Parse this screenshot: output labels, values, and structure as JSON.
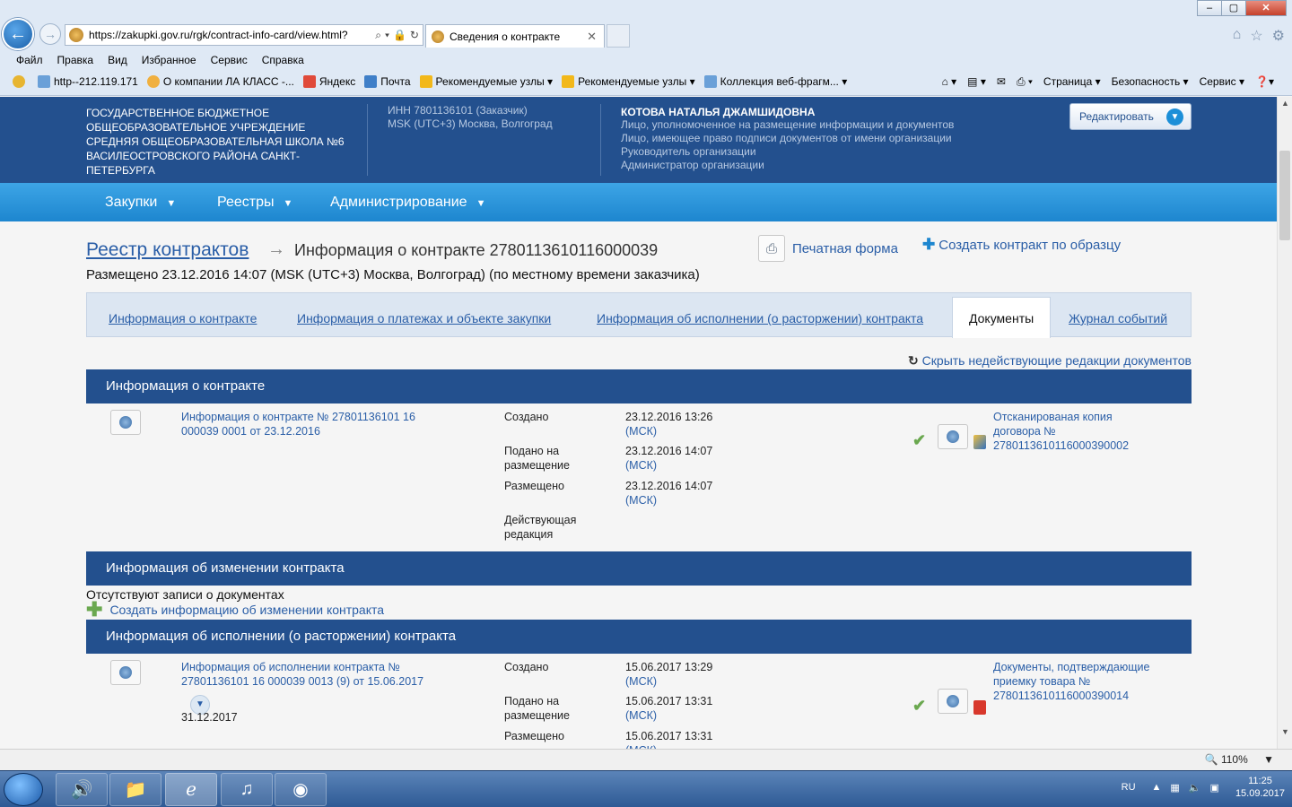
{
  "browser": {
    "address_url": "https://zakupki.gov.ru/rgk/contract-info-card/view.html?",
    "tab_title": "Сведения о контракте",
    "menu": [
      "Файл",
      "Правка",
      "Вид",
      "Избранное",
      "Сервис",
      "Справка"
    ],
    "favorites": [
      "http--212.119.171",
      "О компании ЛА КЛАСС -...",
      "Яндекс",
      "Почта",
      "Рекомендуемые узлы ▾",
      "Рекомендуемые узлы ▾",
      "Коллекция веб-фрагм... ▾"
    ],
    "command_bar": [
      "Страница ▾",
      "Безопасность ▾",
      "Сервис ▾"
    ]
  },
  "header": {
    "org_name": "ГОСУДАРСТВЕННОЕ БЮДЖЕТНОЕ ОБЩЕОБРАЗОВАТЕЛЬНОЕ УЧРЕЖДЕНИЕ СРЕДНЯЯ ОБЩЕОБРАЗОВАТЕЛЬНАЯ ШКОЛА №6 ВАСИЛЕОСТРОВСКОГО РАЙОНА САНКТ-ПЕТЕРБУРГА",
    "inn": "ИНН 7801136101 (Заказчик)",
    "timezone": "MSK (UTC+3) Москва, Волгоград",
    "user_name": "КОТОВА НАТАЛЬЯ ДЖАМШИДОВНА",
    "roles": [
      "Лицо, уполномоченное на размещение информации и документов",
      "Лицо, имеющее право подписи документов от имени организации",
      "Руководитель организации",
      "Администратор организации"
    ],
    "edit_button": "Редактировать"
  },
  "nav": [
    "Закупки",
    "Реестры",
    "Администрирование"
  ],
  "page": {
    "breadcrumb_link": "Реестр контрактов",
    "title": "Информация о контракте 2780113610116000039",
    "posted": "Размещено 23.12.2016 14:07 (MSK (UTC+3) Москва, Волгоград) (по местному времени заказчика)",
    "print_label": "Печатная форма",
    "create_label": "Создать контракт по образцу",
    "tabs": [
      "Информация о контракте",
      "Информация о платежах и объекте закупки",
      "Информация об исполнении (о расторжении) контракта",
      "Документы",
      "Журнал событий"
    ],
    "active_tab": "Документы",
    "hide_link": "Скрыть недействующие редакции документов"
  },
  "section1": {
    "title": "Информация о контракте",
    "doc_link": "Информация о контракте № 27801136101 16 000039 0001 от 23.12.2016",
    "labels": [
      "Создано",
      "Подано на размещение",
      "Размещено",
      "Действующая редакция"
    ],
    "dates": [
      "23.12.2016 13:26",
      "23.12.2016 14:07",
      "23.12.2016 14:07"
    ],
    "tz": "(МСК)",
    "attachment": "Отсканированая копия договора № 2780113610116000390002"
  },
  "section2": {
    "title": "Информация об изменении контракта",
    "empty": "Отсутствуют записи о документах",
    "create_link": "Создать информацию об изменении контракта"
  },
  "section3": {
    "title": "Информация об исполнении (о расторжении) контракта",
    "doc_link": "Информация об исполнении контракта № 27801136101 16 000039 0013 (9) от 15.06.2017",
    "extra_date": "31.12.2017",
    "labels": [
      "Создано",
      "Подано на размещение",
      "Размещено"
    ],
    "dates": [
      "15.06.2017 13:29",
      "15.06.2017 13:31",
      "15.06.2017 13:31"
    ],
    "tz": "(МСК)",
    "attachment": "Документы, подтверждающие приемку товара № 2780113610116000390014"
  },
  "statusbar": {
    "zoom": "110%"
  },
  "taskbar": {
    "lang": "RU",
    "time": "11:25",
    "date": "15.09.2017"
  }
}
